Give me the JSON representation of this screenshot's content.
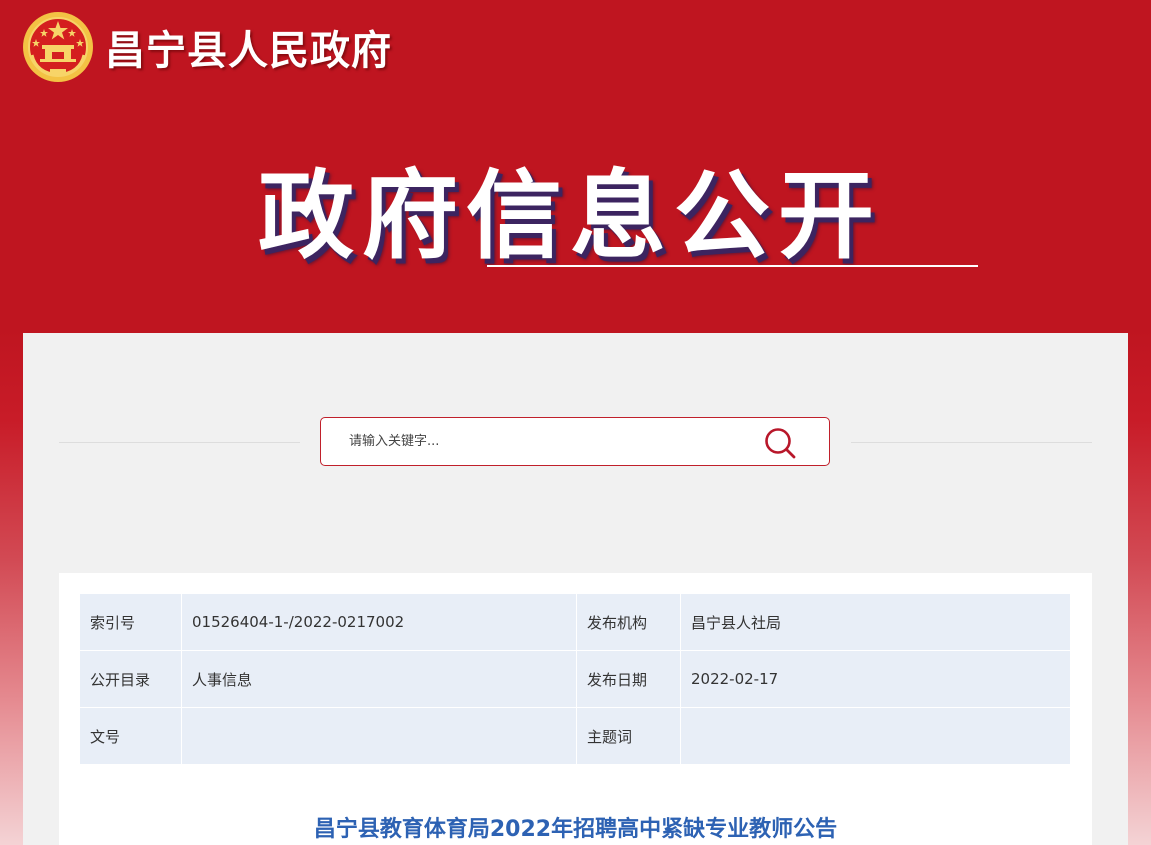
{
  "header": {
    "site_name": "昌宁县人民政府",
    "emblem_icon": "national-emblem-icon",
    "banner_title": "政府信息公开"
  },
  "search": {
    "placeholder": "请输入关键字...",
    "value": "",
    "icon": "search-icon"
  },
  "meta_table": {
    "rows": [
      {
        "label1": "索引号",
        "value1": "01526404-1-/2022-0217002",
        "label2": "发布机构",
        "value2": "昌宁县人社局"
      },
      {
        "label1": "公开目录",
        "value1": "人事信息",
        "label2": "发布日期",
        "value2": "2022-02-17"
      },
      {
        "label1": "文号",
        "value1": "",
        "label2": "主题词",
        "value2": ""
      }
    ]
  },
  "article": {
    "title": "昌宁县教育体育局2022年招聘高中紧缺专业教师公告"
  },
  "colors": {
    "brand_red": "#bf1520",
    "title_blue": "#2d62b3",
    "table_bg": "#e8eef7"
  }
}
